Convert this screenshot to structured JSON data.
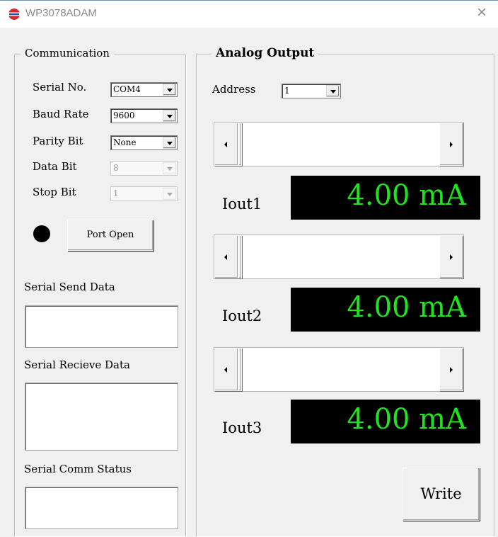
{
  "window": {
    "title": "WP3078ADAM",
    "close_glyph": "×",
    "app_icon": "flag-globe-icon"
  },
  "communication": {
    "legend": "Communication",
    "serial_no": {
      "label": "Serial No.",
      "value": "COM4"
    },
    "baud_rate": {
      "label": "Baud Rate",
      "value": "9600"
    },
    "parity_bit": {
      "label": "Parity Bit",
      "value": "None"
    },
    "data_bit": {
      "label": "Data Bit",
      "value": "8"
    },
    "stop_bit": {
      "label": "Stop Bit",
      "value": "1"
    },
    "port_button": "Port Open",
    "send_label": "Serial Send Data",
    "send_value": "",
    "receive_label": "Serial Recieve Data",
    "receive_value": "",
    "status_label": "Serial Comm Status",
    "status_value": ""
  },
  "analog_output": {
    "legend": "Analog Output",
    "address": {
      "label": "Address",
      "value": "1"
    },
    "channels": [
      {
        "label": "Iout1",
        "display": "4.00 mA",
        "slider_fraction": 0
      },
      {
        "label": "Iout2",
        "display": "4.00 mA",
        "slider_fraction": 0
      },
      {
        "label": "Iout3",
        "display": "4.00 mA",
        "slider_fraction": 0
      }
    ],
    "write_button": "Write"
  },
  "colors": {
    "lcd_background": "#000000",
    "lcd_text": "#1fe41f",
    "led": "#000000"
  }
}
